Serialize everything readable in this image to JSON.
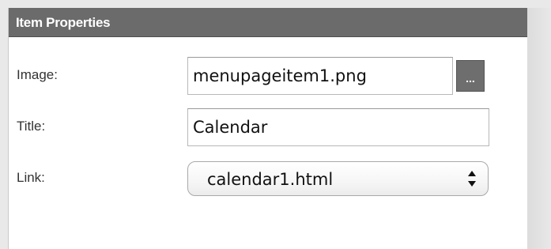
{
  "panel": {
    "title": "Item Properties"
  },
  "fields": {
    "image": {
      "label": "Image:",
      "value": "menupageitem1.png",
      "button_label": "..."
    },
    "title": {
      "label": "Title:",
      "value": "Calendar"
    },
    "link": {
      "label": "Link:",
      "value": "calendar1.html"
    }
  },
  "icons": {
    "select": "up-down-arrows-icon"
  },
  "colors": {
    "header_bg": "#6b6b6b",
    "header_text": "#ffffff",
    "panel_bg": "#ffffff",
    "browse_button_bg": "#6e6e6e"
  }
}
